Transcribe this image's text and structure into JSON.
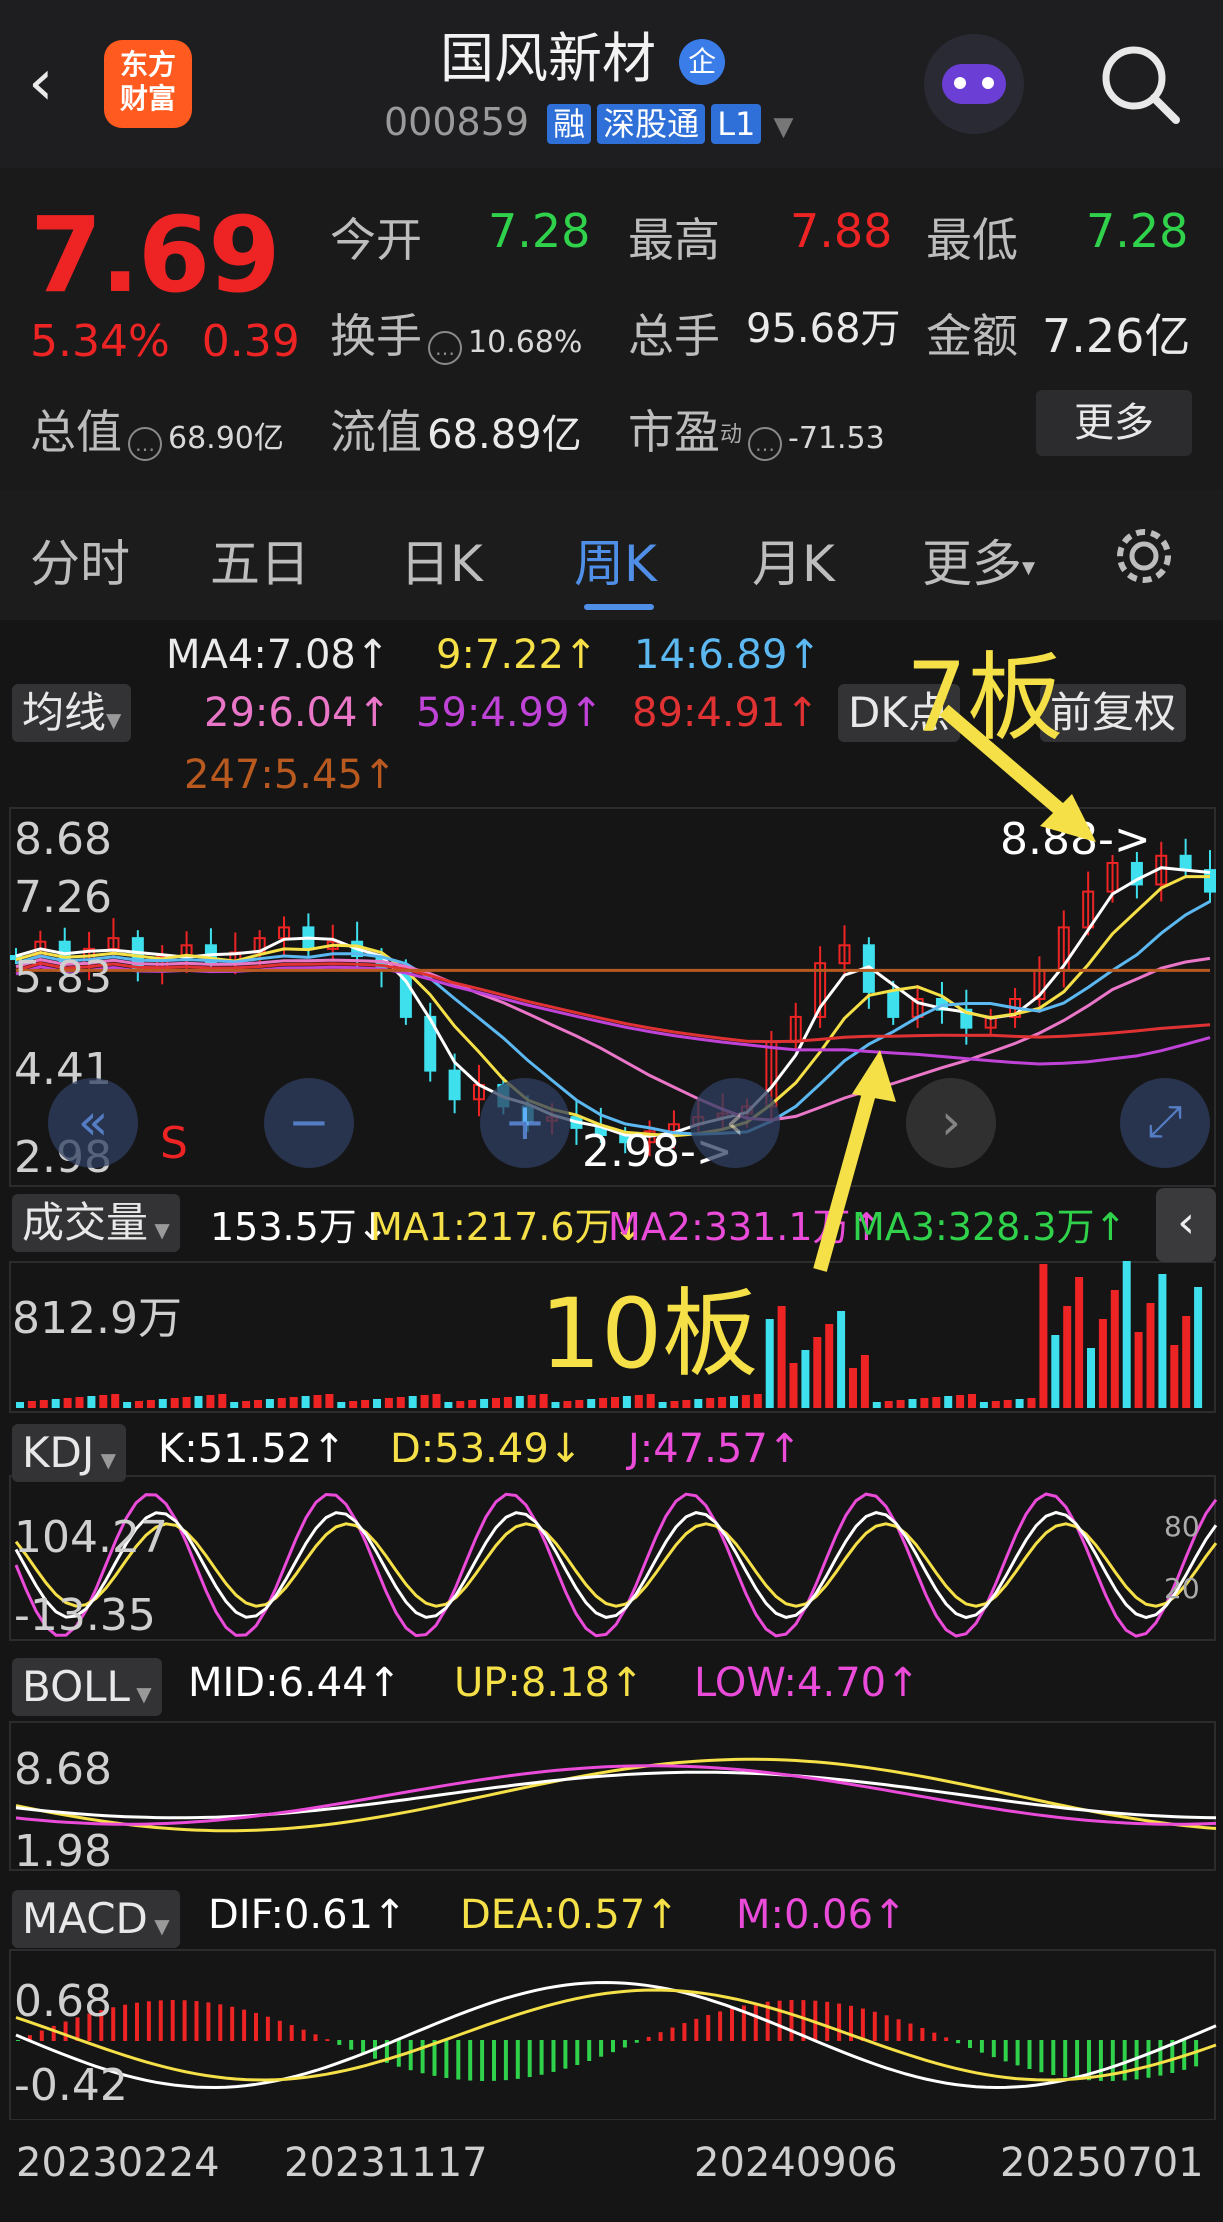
{
  "header": {
    "back_label": "‹",
    "app_logo_text": "东方\n财富",
    "stock_name": "国风新材",
    "badge_qi": "企",
    "stock_code": "000859",
    "tags": [
      "融",
      "深股通",
      "L1"
    ]
  },
  "quote": {
    "price": "7.69",
    "change_pct": "5.34%",
    "change_amt": "0.39",
    "open_label": "今开",
    "open": "7.28",
    "high_label": "最高",
    "high": "7.88",
    "low_label": "最低",
    "low": "7.28",
    "turnover_label": "换手",
    "turnover": "10.68%",
    "volume_label": "总手",
    "volume": "95.68万",
    "amount_label": "金额",
    "amount": "7.26亿",
    "mktcap_label": "总值",
    "mktcap": "68.90亿",
    "float_label": "流值",
    "float_cap": "68.89亿",
    "pe_label": "市盈",
    "pe_sup": "动",
    "pe": "-71.53",
    "more_label": "更多"
  },
  "tabs": [
    "分时",
    "五日",
    "日K",
    "周K",
    "月K",
    "更多"
  ],
  "ma": {
    "ma4": "MA4:7.08↑",
    "ma9": "9:7.22↑",
    "ma14": "14:6.89↑",
    "ma29": "29:6.04↑",
    "ma59": "59:4.99↑",
    "ma89": "89:4.91↑",
    "ma247": "247:5.45↑",
    "junxian": "均线",
    "dk": "DK点",
    "fuquan": "前复权"
  },
  "price_axis": [
    "8.68",
    "7.26",
    "5.83",
    "4.41",
    "2.98"
  ],
  "price_labels": {
    "high_mark": "8.88->",
    "low_mark": "2.98->",
    "s_mark": "S"
  },
  "volume": {
    "label": "成交量",
    "cur": "153.5万↓",
    "ma1": "MA1:217.6万↓",
    "ma2": "MA2:331.1万↑",
    "ma3": "MA3:328.3万↑",
    "axis": "812.9万"
  },
  "kdj": {
    "label": "KDJ",
    "k": "K:51.52↑",
    "d": "D:53.49↓",
    "j": "J:47.57↑",
    "top": "104.27",
    "bot": "-13.35",
    "r80": "80",
    "r20": "20"
  },
  "boll": {
    "label": "BOLL",
    "mid": "MID:6.44↑",
    "up": "UP:8.18↑",
    "low": "LOW:4.70↑",
    "top": "8.68",
    "bot": "1.98"
  },
  "macd": {
    "label": "MACD",
    "dif": "DIF:0.61↑",
    "dea": "DEA:0.57↑",
    "m": "M:0.06↑",
    "top": "0.68",
    "bot": "-0.42"
  },
  "dates": [
    "20230224",
    "20231117",
    "20240906",
    "20250701"
  ],
  "annotations": {
    "a7": "7板",
    "a10": "10板"
  },
  "colors": {
    "up": "#ee2424",
    "down": "#2fd24a",
    "accent": "#4f8fe8",
    "yellow": "#f5e048"
  }
}
